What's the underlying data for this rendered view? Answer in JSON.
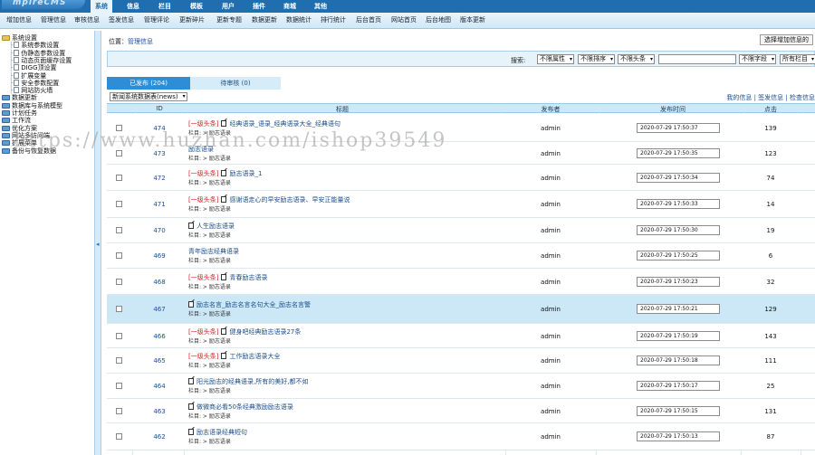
{
  "app": {
    "logo_text": "mpireCMS"
  },
  "topnav": {
    "items": [
      {
        "label": "系统",
        "active": true
      },
      {
        "label": "信息",
        "active": false
      },
      {
        "label": "栏目",
        "active": false
      },
      {
        "label": "模板",
        "active": false
      },
      {
        "label": "用户",
        "active": false
      },
      {
        "label": "插件",
        "active": false
      },
      {
        "label": "商城",
        "active": false
      },
      {
        "label": "其他",
        "active": false
      }
    ]
  },
  "subnav": {
    "items": [
      "增加信息",
      "管理信息",
      "审核信息",
      "签发信息",
      "管理评论",
      "更新碎片",
      "更新专题",
      "数据更新",
      "数据统计",
      "排行统计",
      "后台首页",
      "网站首页",
      "后台地图",
      "版本更新"
    ]
  },
  "sidebar": {
    "items": [
      {
        "label": "系统设置",
        "level": 0,
        "type": "folder-open"
      },
      {
        "label": "系统参数设置",
        "level": 1,
        "type": "page"
      },
      {
        "label": "伪静态参数设置",
        "level": 1,
        "type": "page"
      },
      {
        "label": "动态页面缓存设置",
        "level": 1,
        "type": "page"
      },
      {
        "label": "DIGG顶设置",
        "level": 1,
        "type": "page"
      },
      {
        "label": "扩展变量",
        "level": 1,
        "type": "page"
      },
      {
        "label": "安全参数配置",
        "level": 1,
        "type": "page"
      },
      {
        "label": "网站防火墙",
        "level": 1,
        "type": "page"
      },
      {
        "label": "数据更新",
        "level": 0,
        "type": "folder"
      },
      {
        "label": "数据库与系统模型",
        "level": 0,
        "type": "folder"
      },
      {
        "label": "计划任务",
        "level": 0,
        "type": "folder"
      },
      {
        "label": "工作流",
        "level": 0,
        "type": "folder"
      },
      {
        "label": "优化方案",
        "level": 0,
        "type": "folder"
      },
      {
        "label": "网站多访问端",
        "level": 0,
        "type": "folder"
      },
      {
        "label": "扩展菜单",
        "level": 0,
        "type": "folder"
      },
      {
        "label": "备份与恢复数据",
        "level": 0,
        "type": "folder"
      }
    ]
  },
  "location": {
    "prefix": "位置：",
    "link": "管理信息"
  },
  "toolbar": {
    "add_info_label": "选择增加信息的"
  },
  "search": {
    "label": "搜索:",
    "filters": [
      "不限属性",
      "不限排序",
      "不限头条"
    ],
    "input_value": "",
    "field_select": "不限字段",
    "column_select": "所有栏目"
  },
  "tabs": [
    {
      "label": "已发布 (204)",
      "active": true
    },
    {
      "label": "待审核 (0)",
      "active": false
    }
  ],
  "list_toolbar": {
    "category_select": "新闻系统数据表(news)",
    "quick_links": "我的信息 | 签发信息 | 检查信息"
  },
  "table": {
    "headers": {
      "id": "ID",
      "title": "标题",
      "publisher": "发布者",
      "publish_time": "发布时间",
      "clicks": "点击"
    },
    "rows": [
      {
        "id": "474",
        "tag": "[一级头条]",
        "has_icon": true,
        "title": "经典语录_语录_经典语录大全_经典语句",
        "column": "栏目: > 励志语录",
        "author": "admin",
        "time": "2020-07-29 17:50:37",
        "clicks": "139",
        "selected": false
      },
      {
        "id": "473",
        "tag": "",
        "has_icon": false,
        "title": "励志语录",
        "column": "栏目: > 励志语录",
        "author": "admin",
        "time": "2020-07-29 17:50:35",
        "clicks": "123",
        "selected": false
      },
      {
        "id": "472",
        "tag": "[一级头条]",
        "has_icon": true,
        "title": "励志语录_1",
        "column": "栏目: > 励志语录",
        "author": "admin",
        "time": "2020-07-29 17:50:34",
        "clicks": "74",
        "selected": false
      },
      {
        "id": "471",
        "tag": "[一级头条]",
        "has_icon": true,
        "title": "感谢语走心的早安励志语录、早安正能量说",
        "column": "栏目: > 励志语录",
        "author": "admin",
        "time": "2020-07-29 17:50:33",
        "clicks": "14",
        "selected": false
      },
      {
        "id": "470",
        "tag": "",
        "has_icon": true,
        "title": "人生励志语录",
        "column": "栏目: > 励志语录",
        "author": "admin",
        "time": "2020-07-29 17:50:30",
        "clicks": "19",
        "selected": false
      },
      {
        "id": "469",
        "tag": "",
        "has_icon": false,
        "title": "青年励志经典语录",
        "column": "栏目: > 励志语录",
        "author": "admin",
        "time": "2020-07-29 17:50:25",
        "clicks": "6",
        "selected": false
      },
      {
        "id": "468",
        "tag": "[一级头条]",
        "has_icon": true,
        "title": "青春励志语录",
        "column": "栏目: > 励志语录",
        "author": "admin",
        "time": "2020-07-29 17:50:23",
        "clicks": "32",
        "selected": false
      },
      {
        "id": "467",
        "tag": "",
        "has_icon": true,
        "title": "励志名言_励志名言名句大全_励志名言警",
        "column": "栏目: > 励志语录",
        "author": "admin",
        "time": "2020-07-29 17:50:21",
        "clicks": "129",
        "selected": true
      },
      {
        "id": "466",
        "tag": "[一级头条]",
        "has_icon": true,
        "title": "健身吧经典励志语录27条",
        "column": "栏目: > 励志语录",
        "author": "admin",
        "time": "2020-07-29 17:50:19",
        "clicks": "143",
        "selected": false
      },
      {
        "id": "465",
        "tag": "[一级头条]",
        "has_icon": true,
        "title": "工作励志语录大全",
        "column": "栏目: > 励志语录",
        "author": "admin",
        "time": "2020-07-29 17:50:18",
        "clicks": "111",
        "selected": false
      },
      {
        "id": "464",
        "tag": "",
        "has_icon": true,
        "title": "阳光励志的经典语录,所有的美好,都不如",
        "column": "栏目: > 励志语录",
        "author": "admin",
        "time": "2020-07-29 17:50:17",
        "clicks": "25",
        "selected": false
      },
      {
        "id": "463",
        "tag": "",
        "has_icon": true,
        "title": "做微商必看50条经典激励励志语录",
        "column": "栏目: > 励志语录",
        "author": "admin",
        "time": "2020-07-29 17:50:15",
        "clicks": "131",
        "selected": false
      },
      {
        "id": "462",
        "tag": "",
        "has_icon": true,
        "title": "励志语录经典短句",
        "column": "栏目: > 励志语录",
        "author": "admin",
        "time": "2020-07-29 17:50:13",
        "clicks": "87",
        "selected": false
      }
    ]
  },
  "watermark": {
    "text": "https://www.huzhan.com/ishop39549"
  },
  "colors": {
    "topnav_bg": "#1f6fb0",
    "selected_row": "#cce8f7",
    "head_tag": "#d02020",
    "link": "#1c4f8f"
  }
}
